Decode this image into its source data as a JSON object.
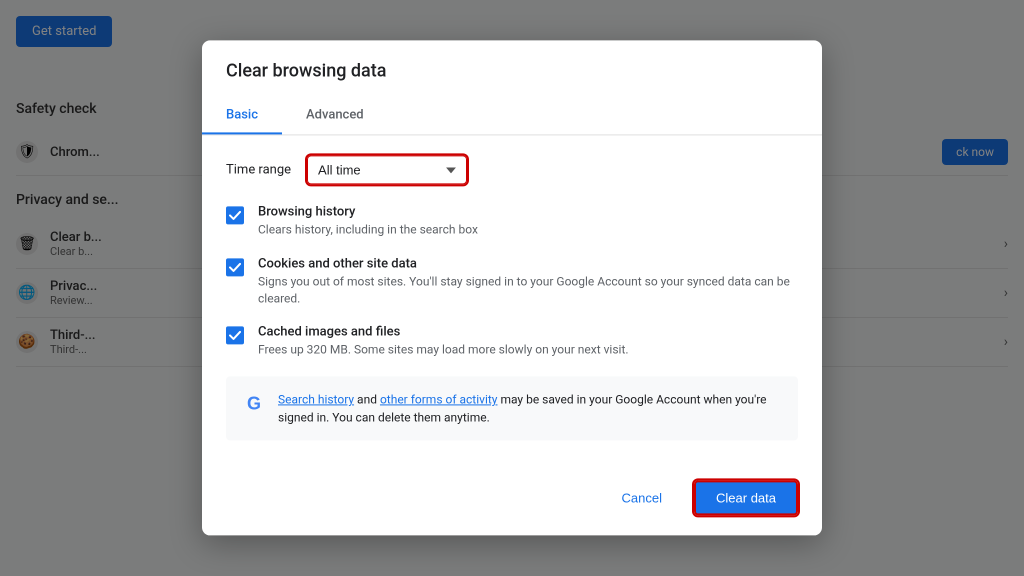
{
  "background": {
    "get_started_label": "Get started",
    "safety_check_title": "Safety check",
    "privacy_section_title": "Privacy and se...",
    "chrome_row_label": "Chrom...",
    "clear_row_title": "Clear b...",
    "clear_row_sub": "Clear b...",
    "privacy_row_title": "Privac...",
    "privacy_row_sub": "Review...",
    "third_row_title": "Third-...",
    "third_row_sub": "Third-...",
    "check_now_label": "ck now"
  },
  "dialog": {
    "title": "Clear browsing data",
    "tabs": [
      {
        "label": "Basic",
        "active": true
      },
      {
        "label": "Advanced",
        "active": false
      }
    ],
    "time_range_label": "Time range",
    "time_range_value": "All time",
    "items": [
      {
        "label": "Browsing history",
        "description": "Clears history, including in the search box",
        "checked": true
      },
      {
        "label": "Cookies and other site data",
        "description": "Signs you out of most sites. You'll stay signed in to your Google Account so your synced data can be cleared.",
        "checked": true
      },
      {
        "label": "Cached images and files",
        "description": "Frees up 320 MB. Some sites may load more slowly on your next visit.",
        "checked": true
      }
    ],
    "google_info": {
      "link1": "Search history",
      "text1": " and ",
      "link2": "other forms of activity",
      "text2": " may be saved in your Google Account when you're signed in. You can delete them anytime."
    },
    "cancel_label": "Cancel",
    "clear_label": "Clear data"
  }
}
